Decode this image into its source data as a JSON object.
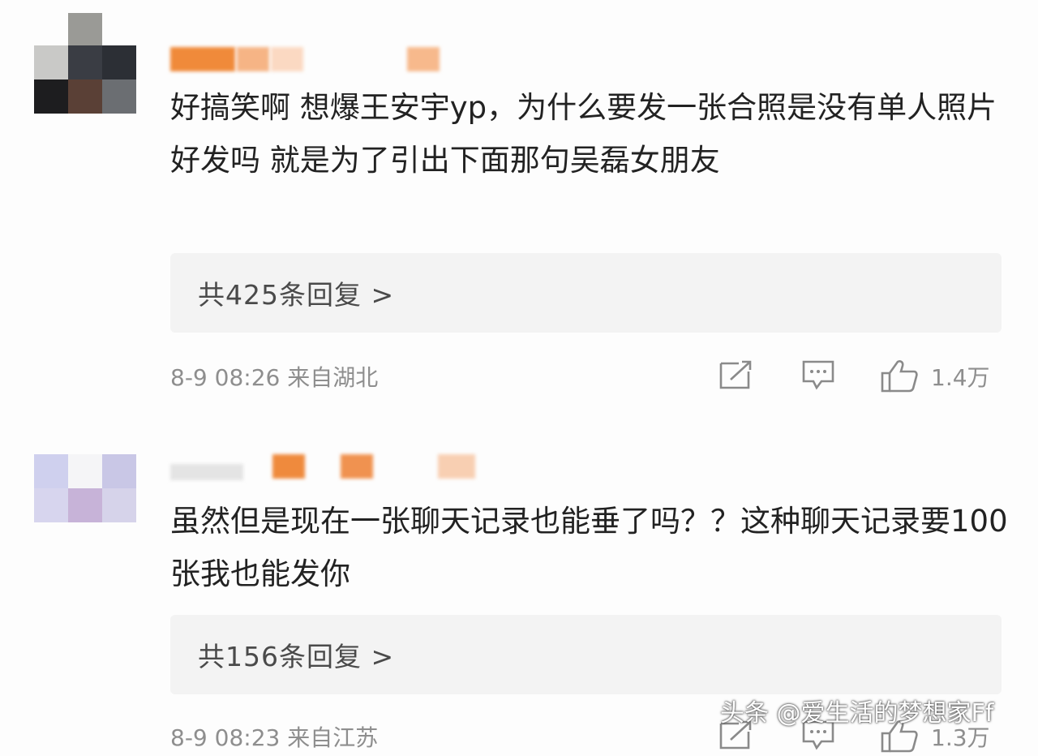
{
  "comments": [
    {
      "text": "好搞笑啊 想爆王安宇yp，为什么要发一张合照是没有单人照片好发吗 就是为了引出下面那句吴磊女朋友",
      "replies_label": "共425条回复 >",
      "timestamp": "8-9 08:26",
      "location": "来自湖北",
      "likes": "1.4万"
    },
    {
      "text": "虽然但是现在一张聊天记录也能垂了吗？？这种聊天记录要100张我也能发你",
      "replies_label": "共156条回复 >",
      "timestamp": "8-9 08:23",
      "location": "来自江苏",
      "likes": "1.3万"
    }
  ],
  "icons": {
    "share": "share-icon",
    "comment": "comment-icon",
    "like": "like-icon"
  },
  "watermark": "头条 @爱生活的梦想家Ff"
}
